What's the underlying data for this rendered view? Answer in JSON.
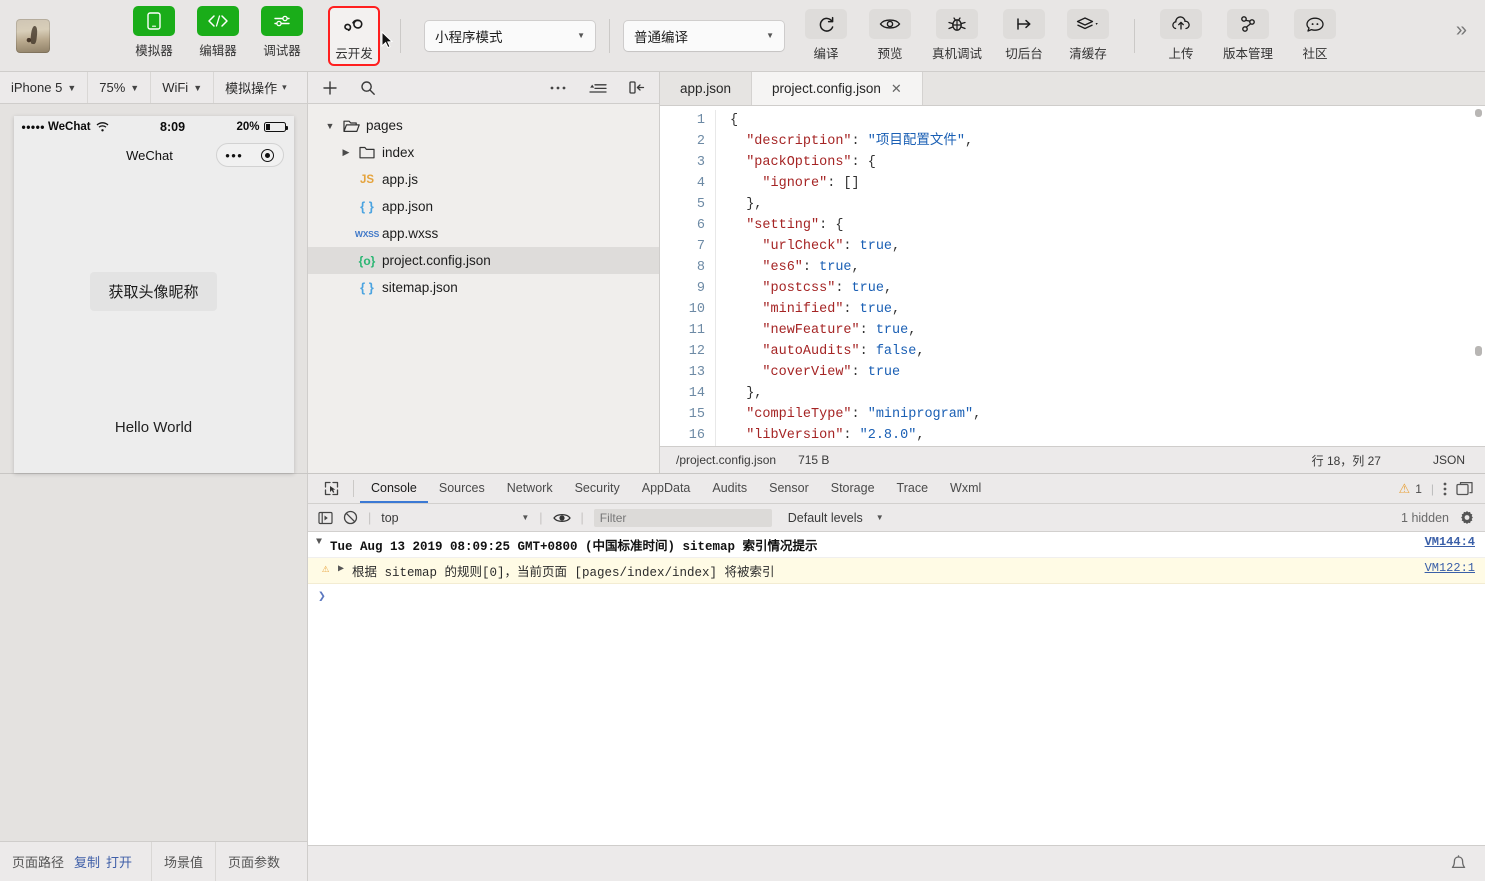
{
  "toolbar": {
    "avatar_name": "project-avatar",
    "buttons": [
      {
        "label": "模拟器",
        "icon": "phone-icon",
        "style": "green"
      },
      {
        "label": "编辑器",
        "icon": "code-icon",
        "style": "green"
      },
      {
        "label": "调试器",
        "icon": "sliders-icon",
        "style": "green"
      },
      {
        "label": "云开发",
        "icon": "cloud-dev-icon",
        "style": "plain",
        "highlighted": true
      }
    ],
    "mode_select": "小程序模式",
    "compile_select": "普通编译",
    "actions": [
      {
        "label": "编译",
        "icon": "refresh-icon"
      },
      {
        "label": "预览",
        "icon": "eye-icon"
      },
      {
        "label": "真机调试",
        "icon": "bug-icon"
      },
      {
        "label": "切后台",
        "icon": "background-icon"
      },
      {
        "label": "清缓存",
        "icon": "layers-icon",
        "has_caret": true
      },
      {
        "label": "上传",
        "icon": "cloud-upload-icon"
      },
      {
        "label": "版本管理",
        "icon": "branch-icon"
      },
      {
        "label": "社区",
        "icon": "chat-icon"
      }
    ],
    "overflow": "»"
  },
  "simulator": {
    "controls": [
      {
        "label": "iPhone 5",
        "has_caret": true
      },
      {
        "label": "75%",
        "has_caret": true
      },
      {
        "label": "WiFi",
        "has_caret": true
      },
      {
        "label": "模拟操作",
        "has_caret": true
      }
    ],
    "status": {
      "carrier": "WeChat",
      "signal_dots": "•••••",
      "wifi": "wifi-icon",
      "time": "8:09",
      "battery_percent": "20%"
    },
    "nav_title": "WeChat",
    "button_label": "获取头像昵称",
    "body_text": "Hello World",
    "bottom": {
      "path_label": "页面路径",
      "copy_label": "复制",
      "open_label": "打开",
      "scene_label": "场景值",
      "params_label": "页面参数"
    }
  },
  "file_tree": {
    "toolbar_icons": [
      "plus-icon",
      "search-icon",
      "more-icon",
      "collapse-icon",
      "panel-toggle-icon"
    ],
    "items": [
      {
        "label": "pages",
        "icon": "folder-open-icon",
        "indent": 0,
        "twisty": "▼",
        "selected": false
      },
      {
        "label": "index",
        "icon": "folder-icon",
        "indent": 1,
        "twisty": "▶",
        "selected": false
      },
      {
        "label": "app.js",
        "icon": "js",
        "icon_text": "JS",
        "indent": 1,
        "twisty": "",
        "selected": false
      },
      {
        "label": "app.json",
        "icon": "json",
        "icon_text": "{ }",
        "indent": 1,
        "twisty": "",
        "selected": false
      },
      {
        "label": "app.wxss",
        "icon": "wxss",
        "icon_text": "WXSS",
        "indent": 1,
        "twisty": "",
        "selected": false
      },
      {
        "label": "project.config.json",
        "icon": "cfg",
        "icon_text": "{o}",
        "indent": 1,
        "twisty": "",
        "selected": true
      },
      {
        "label": "sitemap.json",
        "icon": "json",
        "icon_text": "{ }",
        "indent": 1,
        "twisty": "",
        "selected": false
      }
    ]
  },
  "editor": {
    "tabs": [
      {
        "label": "app.json",
        "active": false,
        "closable": false
      },
      {
        "label": "project.config.json",
        "active": true,
        "closable": true,
        "close": "✕"
      }
    ],
    "lines": [
      {
        "n": "1",
        "tokens": [
          {
            "t": "{",
            "c": "p"
          }
        ]
      },
      {
        "n": "2",
        "tokens": [
          {
            "t": "  \"description\"",
            "c": "k"
          },
          {
            "t": ": ",
            "c": "p"
          },
          {
            "t": "\"项目配置文件\"",
            "c": "s"
          },
          {
            "t": ",",
            "c": "p"
          }
        ]
      },
      {
        "n": "3",
        "tokens": [
          {
            "t": "  \"packOptions\"",
            "c": "k"
          },
          {
            "t": ": {",
            "c": "p"
          }
        ]
      },
      {
        "n": "4",
        "tokens": [
          {
            "t": "    \"ignore\"",
            "c": "k"
          },
          {
            "t": ": []",
            "c": "p"
          }
        ]
      },
      {
        "n": "5",
        "tokens": [
          {
            "t": "  },",
            "c": "p"
          }
        ]
      },
      {
        "n": "6",
        "tokens": [
          {
            "t": "  \"setting\"",
            "c": "k"
          },
          {
            "t": ": {",
            "c": "p"
          }
        ]
      },
      {
        "n": "7",
        "tokens": [
          {
            "t": "    \"urlCheck\"",
            "c": "k"
          },
          {
            "t": ": ",
            "c": "p"
          },
          {
            "t": "true",
            "c": "b"
          },
          {
            "t": ",",
            "c": "p"
          }
        ]
      },
      {
        "n": "8",
        "tokens": [
          {
            "t": "    \"es6\"",
            "c": "k"
          },
          {
            "t": ": ",
            "c": "p"
          },
          {
            "t": "true",
            "c": "b"
          },
          {
            "t": ",",
            "c": "p"
          }
        ]
      },
      {
        "n": "9",
        "tokens": [
          {
            "t": "    \"postcss\"",
            "c": "k"
          },
          {
            "t": ": ",
            "c": "p"
          },
          {
            "t": "true",
            "c": "b"
          },
          {
            "t": ",",
            "c": "p"
          }
        ]
      },
      {
        "n": "10",
        "tokens": [
          {
            "t": "    \"minified\"",
            "c": "k"
          },
          {
            "t": ": ",
            "c": "p"
          },
          {
            "t": "true",
            "c": "b"
          },
          {
            "t": ",",
            "c": "p"
          }
        ]
      },
      {
        "n": "11",
        "tokens": [
          {
            "t": "    \"newFeature\"",
            "c": "k"
          },
          {
            "t": ": ",
            "c": "p"
          },
          {
            "t": "true",
            "c": "b"
          },
          {
            "t": ",",
            "c": "p"
          }
        ]
      },
      {
        "n": "12",
        "tokens": [
          {
            "t": "    \"autoAudits\"",
            "c": "k"
          },
          {
            "t": ": ",
            "c": "p"
          },
          {
            "t": "false",
            "c": "b"
          },
          {
            "t": ",",
            "c": "p"
          }
        ]
      },
      {
        "n": "13",
        "tokens": [
          {
            "t": "    \"coverView\"",
            "c": "k"
          },
          {
            "t": ": ",
            "c": "p"
          },
          {
            "t": "true",
            "c": "b"
          }
        ]
      },
      {
        "n": "14",
        "tokens": [
          {
            "t": "  },",
            "c": "p"
          }
        ]
      },
      {
        "n": "15",
        "tokens": [
          {
            "t": "  \"compileType\"",
            "c": "k"
          },
          {
            "t": ": ",
            "c": "p"
          },
          {
            "t": "\"miniprogram\"",
            "c": "s"
          },
          {
            "t": ",",
            "c": "p"
          }
        ]
      },
      {
        "n": "16",
        "tokens": [
          {
            "t": "  \"libVersion\"",
            "c": "k"
          },
          {
            "t": ": ",
            "c": "p"
          },
          {
            "t": "\"2.8.0\"",
            "c": "s"
          },
          {
            "t": ",",
            "c": "p"
          }
        ]
      }
    ],
    "status": {
      "file_path": "/project.config.json",
      "file_size": "715 B",
      "cursor": "行 18，列 27",
      "language": "JSON"
    }
  },
  "devtools": {
    "tabs": [
      {
        "label": "Console",
        "active": true
      },
      {
        "label": "Sources",
        "active": false
      },
      {
        "label": "Network",
        "active": false
      },
      {
        "label": "Security",
        "active": false
      },
      {
        "label": "AppData",
        "active": false
      },
      {
        "label": "Audits",
        "active": false
      },
      {
        "label": "Sensor",
        "active": false
      },
      {
        "label": "Storage",
        "active": false
      },
      {
        "label": "Trace",
        "active": false
      },
      {
        "label": "Wxml",
        "active": false
      }
    ],
    "warning_count": "1",
    "filter_bar": {
      "context": "top",
      "filter_placeholder": "Filter",
      "levels": "Default levels",
      "hidden_count": "1 hidden"
    },
    "logs": [
      {
        "type": "group",
        "arrow": "▼",
        "text": "Tue Aug 13 2019 08:09:25 GMT+0800 (中国标准时间) sitemap 索引情况提示",
        "source": "VM144:4"
      },
      {
        "type": "warn",
        "arrow": "▶",
        "text": "根据 sitemap 的规则[0]，当前页面 [pages/index/index] 将被索引",
        "source": "VM122:1"
      }
    ],
    "prompt": "❯"
  }
}
